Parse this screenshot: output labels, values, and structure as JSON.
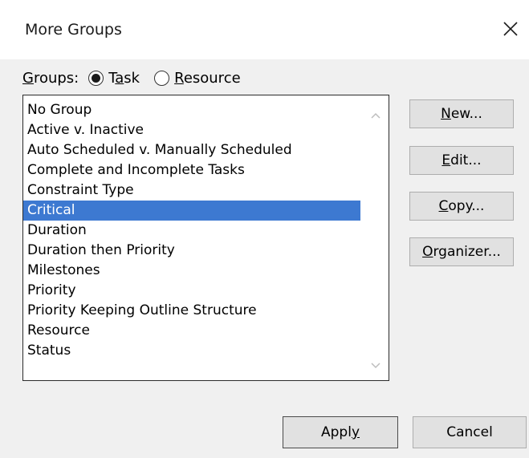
{
  "window": {
    "title": "More Groups"
  },
  "groups": {
    "label_prefix": "",
    "label_underlined": "G",
    "label_rest": "roups:",
    "options": [
      {
        "pre": "T",
        "ul": "a",
        "post": "sk",
        "selected": true
      },
      {
        "pre": "",
        "ul": "R",
        "post": "esource",
        "selected": false
      }
    ]
  },
  "list": {
    "items": [
      "No Group",
      "Active v. Inactive",
      "Auto Scheduled v. Manually Scheduled",
      "Complete and Incomplete Tasks",
      "Constraint Type",
      "Critical",
      "Duration",
      "Duration then Priority",
      "Milestones",
      "Priority",
      "Priority Keeping Outline Structure",
      "Resource",
      "Status"
    ],
    "selected_index": 5,
    "selection_color": "#3d79d1"
  },
  "buttons": {
    "new": {
      "ul": "N",
      "rest": "ew..."
    },
    "edit": {
      "ul": "E",
      "rest": "dit..."
    },
    "copy": {
      "ul": "C",
      "rest": "opy..."
    },
    "organizer": {
      "ul": "O",
      "rest": "rganizer..."
    },
    "apply": {
      "pre": "Appl",
      "ul": "y"
    },
    "cancel": {
      "label": "Cancel"
    }
  },
  "icons": {
    "close": "close-icon",
    "scroll_up": "chevron-up-icon",
    "scroll_down": "chevron-down-icon"
  }
}
